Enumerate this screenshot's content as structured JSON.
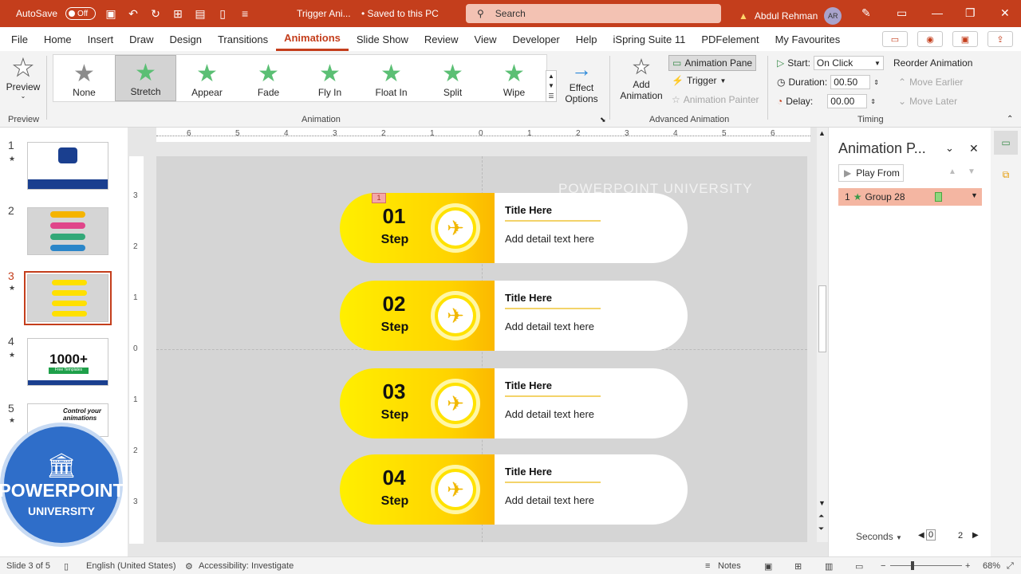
{
  "titlebar": {
    "autosave_label": "AutoSave",
    "autosave_state": "Off",
    "doc_name": "Trigger Ani...",
    "save_status": "• Saved to this PC",
    "search_placeholder": "Search",
    "user_name": "Abdul Rehman",
    "user_initials": "AR"
  },
  "tabs": [
    "File",
    "Home",
    "Insert",
    "Draw",
    "Design",
    "Transitions",
    "Animations",
    "Slide Show",
    "Review",
    "View",
    "Developer",
    "Help",
    "iSpring Suite 11",
    "PDFelement",
    "My Favourites"
  ],
  "active_tab": "Animations",
  "ribbon": {
    "preview_label": "Preview",
    "preview_group": "Preview",
    "animations": [
      {
        "label": "None",
        "icon": "star-outline-icon"
      },
      {
        "label": "Stretch",
        "icon": "star-icon",
        "selected": true
      },
      {
        "label": "Appear",
        "icon": "star-icon"
      },
      {
        "label": "Fade",
        "icon": "star-icon"
      },
      {
        "label": "Fly In",
        "icon": "star-icon"
      },
      {
        "label": "Float In",
        "icon": "star-icon"
      },
      {
        "label": "Split",
        "icon": "star-icon"
      },
      {
        "label": "Wipe",
        "icon": "star-icon"
      }
    ],
    "effect_options_1": "Effect",
    "effect_options_2": "Options",
    "animation_group": "Animation",
    "add_animation_1": "Add",
    "add_animation_2": "Animation",
    "animation_pane": "Animation Pane",
    "trigger": "Trigger",
    "animation_painter": "Animation Painter",
    "advanced_group": "Advanced Animation",
    "start_label": "Start:",
    "start_value": "On Click",
    "duration_label": "Duration:",
    "duration_value": "00.50",
    "delay_label": "Delay:",
    "delay_value": "00.00",
    "reorder": "Reorder Animation",
    "move_earlier": "Move Earlier",
    "move_later": "Move Later",
    "timing_group": "Timing"
  },
  "thumbnails": [
    {
      "num": "1",
      "star": "★"
    },
    {
      "num": "2",
      "star": ""
    },
    {
      "num": "3",
      "star": "★"
    },
    {
      "num": "4",
      "star": "★"
    },
    {
      "num": "5",
      "star": "★"
    }
  ],
  "thumb4_text": "1000+",
  "thumb4_sub": "Free Templates",
  "thumb5_text": "Control your animations",
  "logo": {
    "line1": "POWERPOINT",
    "line2": "UNIVERSITY"
  },
  "slide": {
    "watermark": "POWERPOINT UNIVERSITY",
    "step_label": "Step",
    "steps": [
      {
        "num": "01",
        "title": "Title Here",
        "detail": "Add detail text here"
      },
      {
        "num": "02",
        "title": "Title Here",
        "detail": "Add detail text here"
      },
      {
        "num": "03",
        "title": "Title Here",
        "detail": "Add detail text here"
      },
      {
        "num": "04",
        "title": "Title Here",
        "detail": "Add detail text here"
      }
    ],
    "anim_badge": "1"
  },
  "ruler_h": [
    "6",
    "5",
    "4",
    "3",
    "2",
    "1",
    "0",
    "1",
    "2",
    "3",
    "4",
    "5",
    "6"
  ],
  "ruler_v": [
    "3",
    "2",
    "1",
    "0",
    "1",
    "2",
    "3"
  ],
  "pane": {
    "title": "Animation P...",
    "play_from": "Play From",
    "item_index": "1",
    "item_name": "Group 28",
    "seconds": "Seconds",
    "timeline_start": "0",
    "timeline_end": "2"
  },
  "status": {
    "slide_info": "Slide 3 of 5",
    "language": "English (United States)",
    "accessibility": "Accessibility: Investigate",
    "notes": "Notes",
    "zoom": "68%"
  }
}
